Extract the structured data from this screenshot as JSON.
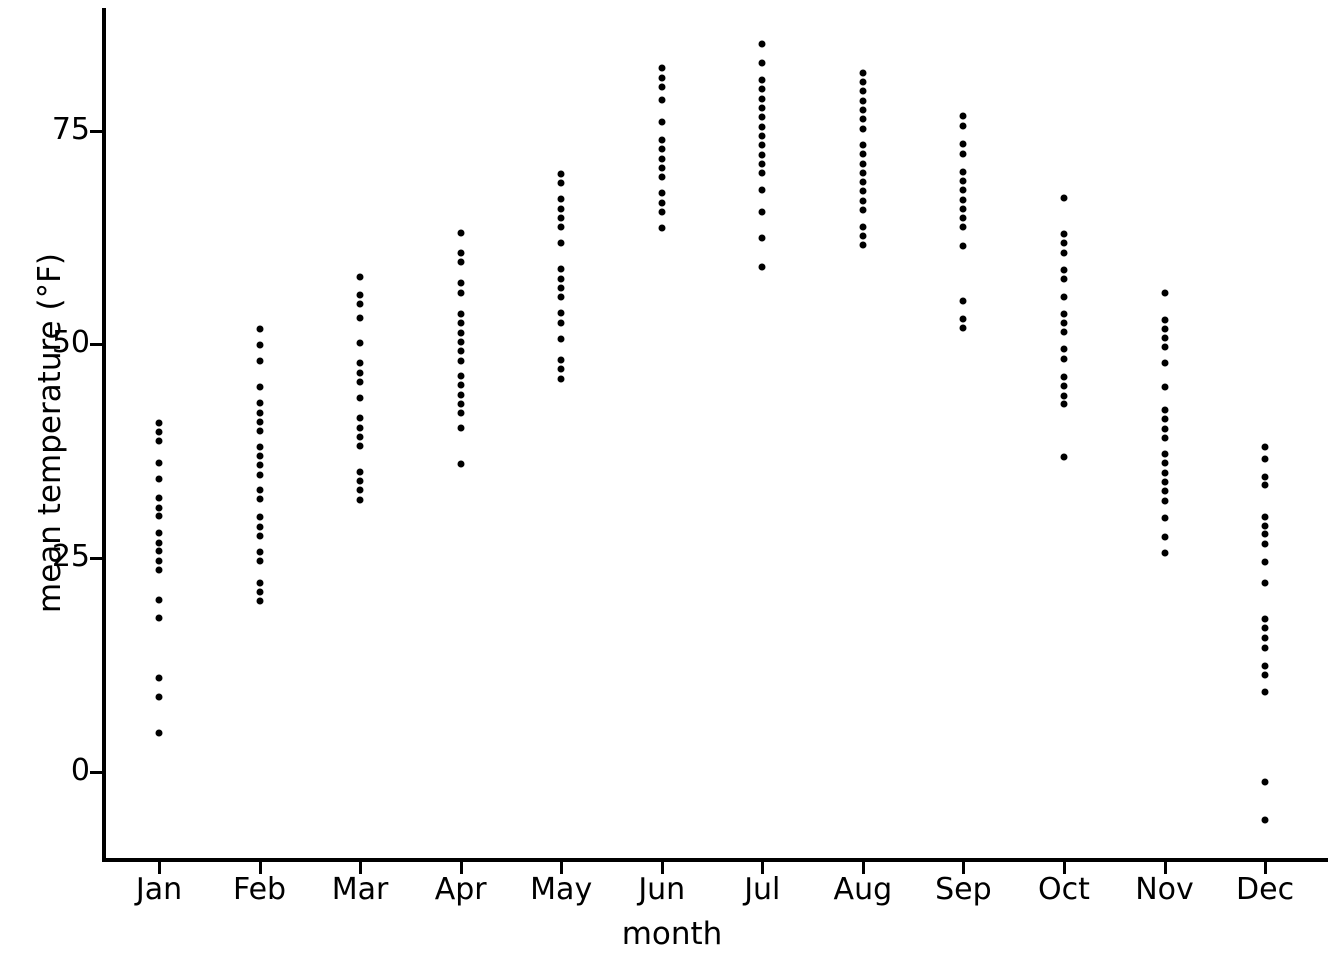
{
  "chart_data": {
    "type": "scatter",
    "title": "",
    "xlabel": "month",
    "ylabel": "mean temperature (°F)",
    "grid": false,
    "legend": "none",
    "xlim": [
      0.4,
      12.6
    ],
    "ylim": [
      -10,
      88
    ],
    "y_ticks": [
      0,
      25,
      50,
      75
    ],
    "y_tick_labels": [
      "0",
      "25",
      "50",
      "75"
    ],
    "categories": [
      "Jan",
      "Feb",
      "Mar",
      "Apr",
      "May",
      "Jun",
      "Jul",
      "Aug",
      "Sep",
      "Oct",
      "Nov",
      "Dec"
    ],
    "series": [
      {
        "name": "Jan",
        "values": [
          40.8,
          39.8,
          38.7,
          36.1,
          34.2,
          32.0,
          30.9,
          29.9,
          27.9,
          26.8,
          25.8,
          24.7,
          23.6,
          20.1,
          18.0,
          11.0,
          8.8,
          4.6
        ]
      },
      {
        "name": "Feb",
        "values": [
          51.8,
          49.9,
          48.1,
          45.0,
          43.1,
          42.0,
          40.9,
          39.9,
          38.0,
          36.9,
          35.9,
          34.7,
          33.0,
          31.9,
          29.8,
          28.6,
          27.6,
          25.7,
          24.7,
          22.1,
          21.0,
          20.0
        ]
      },
      {
        "name": "Mar",
        "values": [
          57.9,
          55.8,
          54.7,
          53.1,
          50.2,
          47.8,
          46.7,
          45.6,
          43.7,
          41.4,
          40.2,
          39.2,
          38.1,
          35.1,
          34.0,
          33.0,
          31.8
        ]
      },
      {
        "name": "Apr",
        "values": [
          63.0,
          60.7,
          59.6,
          57.2,
          56.0,
          53.6,
          52.5,
          51.3,
          50.3,
          49.2,
          48.1,
          46.3,
          45.2,
          44.1,
          43.0,
          42.0,
          40.2,
          36.0
        ]
      },
      {
        "name": "May",
        "values": [
          69.9,
          68.9,
          67.0,
          65.8,
          64.8,
          63.7,
          61.8,
          58.8,
          57.6,
          56.6,
          55.5,
          53.7,
          52.5,
          50.6,
          48.2,
          47.1,
          46.0
        ]
      },
      {
        "name": "Jun",
        "values": [
          82.3,
          81.1,
          80.1,
          78.6,
          76.0,
          73.9,
          72.8,
          71.7,
          70.6,
          69.6,
          67.7,
          66.5,
          65.5,
          63.6
        ]
      },
      {
        "name": "Jul",
        "values": [
          85.1,
          82.9,
          80.9,
          79.8,
          78.7,
          77.6,
          76.6,
          75.4,
          74.3,
          73.3,
          72.1,
          71.1,
          70.0,
          68.0,
          65.5,
          62.4,
          59.0
        ]
      },
      {
        "name": "Aug",
        "values": [
          81.7,
          80.7,
          79.6,
          78.5,
          77.4,
          76.3,
          75.2,
          73.3,
          72.3,
          71.1,
          70.0,
          69.0,
          67.9,
          66.8,
          65.7,
          63.7,
          62.7,
          61.6
        ]
      },
      {
        "name": "Sep",
        "values": [
          76.7,
          75.5,
          73.4,
          72.3,
          70.2,
          69.1,
          68.0,
          66.9,
          65.8,
          64.8,
          63.7,
          61.5,
          55.1,
          53.0,
          51.9
        ]
      },
      {
        "name": "Oct",
        "values": [
          67.1,
          62.9,
          61.8,
          60.7,
          58.7,
          57.6,
          55.5,
          53.6,
          52.5,
          51.4,
          49.4,
          48.3,
          46.2,
          45.1,
          44.0,
          43.0,
          36.8
        ]
      },
      {
        "name": "Nov",
        "values": [
          56.0,
          52.9,
          51.8,
          50.7,
          49.7,
          47.8,
          45.0,
          42.3,
          41.3,
          40.1,
          39.0,
          37.2,
          36.1,
          35.0,
          33.9,
          32.8,
          31.7,
          29.7,
          27.5,
          25.6
        ]
      },
      {
        "name": "Dec",
        "values": [
          38.0,
          36.6,
          34.5,
          33.5,
          29.8,
          28.8,
          27.8,
          26.6,
          24.5,
          22.1,
          17.9,
          16.8,
          15.7,
          14.5,
          12.4,
          11.3,
          9.4,
          -1.2,
          -5.6
        ]
      }
    ]
  }
}
